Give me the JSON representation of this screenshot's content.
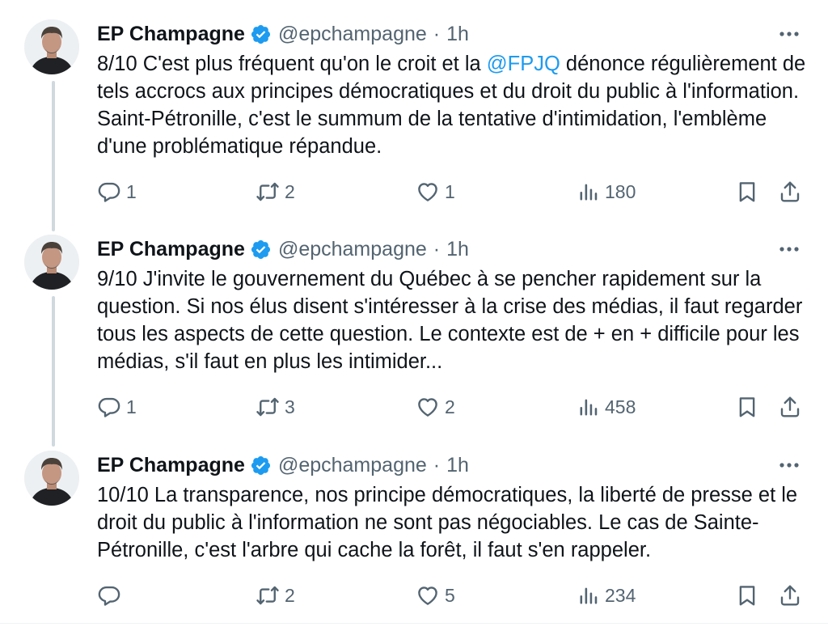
{
  "colors": {
    "accent": "#1d9bf0",
    "text": "#0f1419",
    "muted": "#536471",
    "thread_line": "#cfd9de"
  },
  "tweets": [
    {
      "author": {
        "name": "EP Champagne",
        "handle": "@epchampagne",
        "verified": true
      },
      "separator": "·",
      "time": "1h",
      "text": {
        "before": "8/10 C'est plus fréquent qu'on le croit et la ",
        "mention": "@FPJQ",
        "after": " dénonce régulièrement de tels accrocs aux principes démocratiques et du droit du public à l'information. Saint-Pétronille, c'est le summum de la tentative d'intimidation, l'emblème d'une problématique répandue."
      },
      "stats": {
        "replies": "1",
        "reposts": "2",
        "likes": "1",
        "views": "180"
      }
    },
    {
      "author": {
        "name": "EP Champagne",
        "handle": "@epchampagne",
        "verified": true
      },
      "separator": "·",
      "time": "1h",
      "text": {
        "before": "9/10 J'invite le gouvernement du Québec à se pencher rapidement sur la question. Si nos élus disent s'intéresser à la crise des médias, il faut regarder tous les aspects de cette question. Le contexte est de + en + difficile pour les médias, s'il faut en plus les intimider...",
        "mention": "",
        "after": ""
      },
      "stats": {
        "replies": "1",
        "reposts": "3",
        "likes": "2",
        "views": "458"
      }
    },
    {
      "author": {
        "name": "EP Champagne",
        "handle": "@epchampagne",
        "verified": true
      },
      "separator": "·",
      "time": "1h",
      "text": {
        "before": "10/10 La transparence, nos principe démocratiques, la liberté de presse et le droit du public à l'information ne sont pas négociables. Le cas de Sainte-Pétronille, c'est l'arbre qui cache la forêt, il faut s'en rappeler.",
        "mention": "",
        "after": ""
      },
      "stats": {
        "replies": "",
        "reposts": "2",
        "likes": "5",
        "views": "234"
      }
    }
  ],
  "icons": {
    "more": "more-options-icon",
    "verified": "verified-badge-icon",
    "reply": "reply-icon",
    "repost": "repost-icon",
    "like": "like-icon",
    "views": "views-icon",
    "bookmark": "bookmark-icon",
    "share": "share-icon"
  }
}
